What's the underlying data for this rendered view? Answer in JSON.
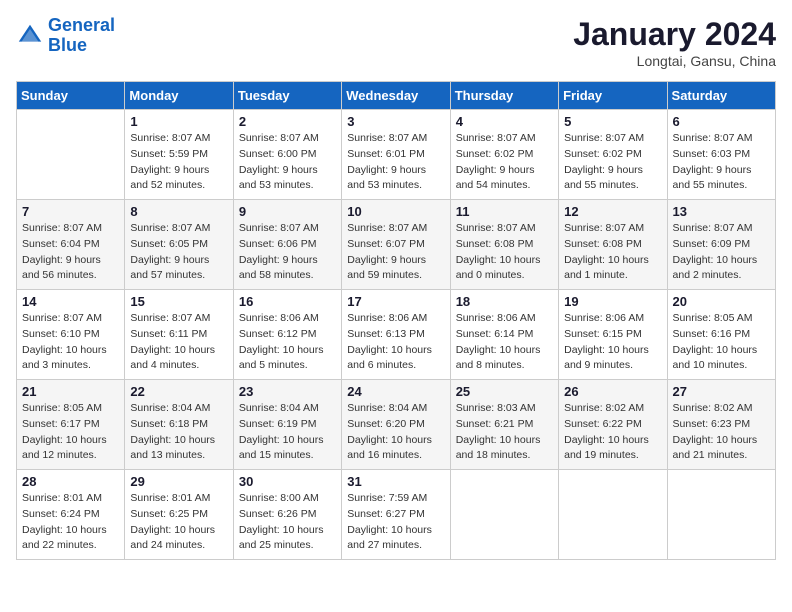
{
  "header": {
    "logo_general": "General",
    "logo_blue": "Blue",
    "month": "January 2024",
    "location": "Longtai, Gansu, China"
  },
  "days_of_week": [
    "Sunday",
    "Monday",
    "Tuesday",
    "Wednesday",
    "Thursday",
    "Friday",
    "Saturday"
  ],
  "weeks": [
    [
      {
        "day": null
      },
      {
        "day": 1,
        "sunrise": "8:07 AM",
        "sunset": "5:59 PM",
        "daylight": "9 hours and 52 minutes."
      },
      {
        "day": 2,
        "sunrise": "8:07 AM",
        "sunset": "6:00 PM",
        "daylight": "9 hours and 53 minutes."
      },
      {
        "day": 3,
        "sunrise": "8:07 AM",
        "sunset": "6:01 PM",
        "daylight": "9 hours and 53 minutes."
      },
      {
        "day": 4,
        "sunrise": "8:07 AM",
        "sunset": "6:02 PM",
        "daylight": "9 hours and 54 minutes."
      },
      {
        "day": 5,
        "sunrise": "8:07 AM",
        "sunset": "6:02 PM",
        "daylight": "9 hours and 55 minutes."
      },
      {
        "day": 6,
        "sunrise": "8:07 AM",
        "sunset": "6:03 PM",
        "daylight": "9 hours and 55 minutes."
      }
    ],
    [
      {
        "day": 7,
        "sunrise": "8:07 AM",
        "sunset": "6:04 PM",
        "daylight": "9 hours and 56 minutes."
      },
      {
        "day": 8,
        "sunrise": "8:07 AM",
        "sunset": "6:05 PM",
        "daylight": "9 hours and 57 minutes."
      },
      {
        "day": 9,
        "sunrise": "8:07 AM",
        "sunset": "6:06 PM",
        "daylight": "9 hours and 58 minutes."
      },
      {
        "day": 10,
        "sunrise": "8:07 AM",
        "sunset": "6:07 PM",
        "daylight": "9 hours and 59 minutes."
      },
      {
        "day": 11,
        "sunrise": "8:07 AM",
        "sunset": "6:08 PM",
        "daylight": "10 hours and 0 minutes."
      },
      {
        "day": 12,
        "sunrise": "8:07 AM",
        "sunset": "6:08 PM",
        "daylight": "10 hours and 1 minute."
      },
      {
        "day": 13,
        "sunrise": "8:07 AM",
        "sunset": "6:09 PM",
        "daylight": "10 hours and 2 minutes."
      }
    ],
    [
      {
        "day": 14,
        "sunrise": "8:07 AM",
        "sunset": "6:10 PM",
        "daylight": "10 hours and 3 minutes."
      },
      {
        "day": 15,
        "sunrise": "8:07 AM",
        "sunset": "6:11 PM",
        "daylight": "10 hours and 4 minutes."
      },
      {
        "day": 16,
        "sunrise": "8:06 AM",
        "sunset": "6:12 PM",
        "daylight": "10 hours and 5 minutes."
      },
      {
        "day": 17,
        "sunrise": "8:06 AM",
        "sunset": "6:13 PM",
        "daylight": "10 hours and 6 minutes."
      },
      {
        "day": 18,
        "sunrise": "8:06 AM",
        "sunset": "6:14 PM",
        "daylight": "10 hours and 8 minutes."
      },
      {
        "day": 19,
        "sunrise": "8:06 AM",
        "sunset": "6:15 PM",
        "daylight": "10 hours and 9 minutes."
      },
      {
        "day": 20,
        "sunrise": "8:05 AM",
        "sunset": "6:16 PM",
        "daylight": "10 hours and 10 minutes."
      }
    ],
    [
      {
        "day": 21,
        "sunrise": "8:05 AM",
        "sunset": "6:17 PM",
        "daylight": "10 hours and 12 minutes."
      },
      {
        "day": 22,
        "sunrise": "8:04 AM",
        "sunset": "6:18 PM",
        "daylight": "10 hours and 13 minutes."
      },
      {
        "day": 23,
        "sunrise": "8:04 AM",
        "sunset": "6:19 PM",
        "daylight": "10 hours and 15 minutes."
      },
      {
        "day": 24,
        "sunrise": "8:04 AM",
        "sunset": "6:20 PM",
        "daylight": "10 hours and 16 minutes."
      },
      {
        "day": 25,
        "sunrise": "8:03 AM",
        "sunset": "6:21 PM",
        "daylight": "10 hours and 18 minutes."
      },
      {
        "day": 26,
        "sunrise": "8:02 AM",
        "sunset": "6:22 PM",
        "daylight": "10 hours and 19 minutes."
      },
      {
        "day": 27,
        "sunrise": "8:02 AM",
        "sunset": "6:23 PM",
        "daylight": "10 hours and 21 minutes."
      }
    ],
    [
      {
        "day": 28,
        "sunrise": "8:01 AM",
        "sunset": "6:24 PM",
        "daylight": "10 hours and 22 minutes."
      },
      {
        "day": 29,
        "sunrise": "8:01 AM",
        "sunset": "6:25 PM",
        "daylight": "10 hours and 24 minutes."
      },
      {
        "day": 30,
        "sunrise": "8:00 AM",
        "sunset": "6:26 PM",
        "daylight": "10 hours and 25 minutes."
      },
      {
        "day": 31,
        "sunrise": "7:59 AM",
        "sunset": "6:27 PM",
        "daylight": "10 hours and 27 minutes."
      },
      {
        "day": null
      },
      {
        "day": null
      },
      {
        "day": null
      }
    ]
  ]
}
